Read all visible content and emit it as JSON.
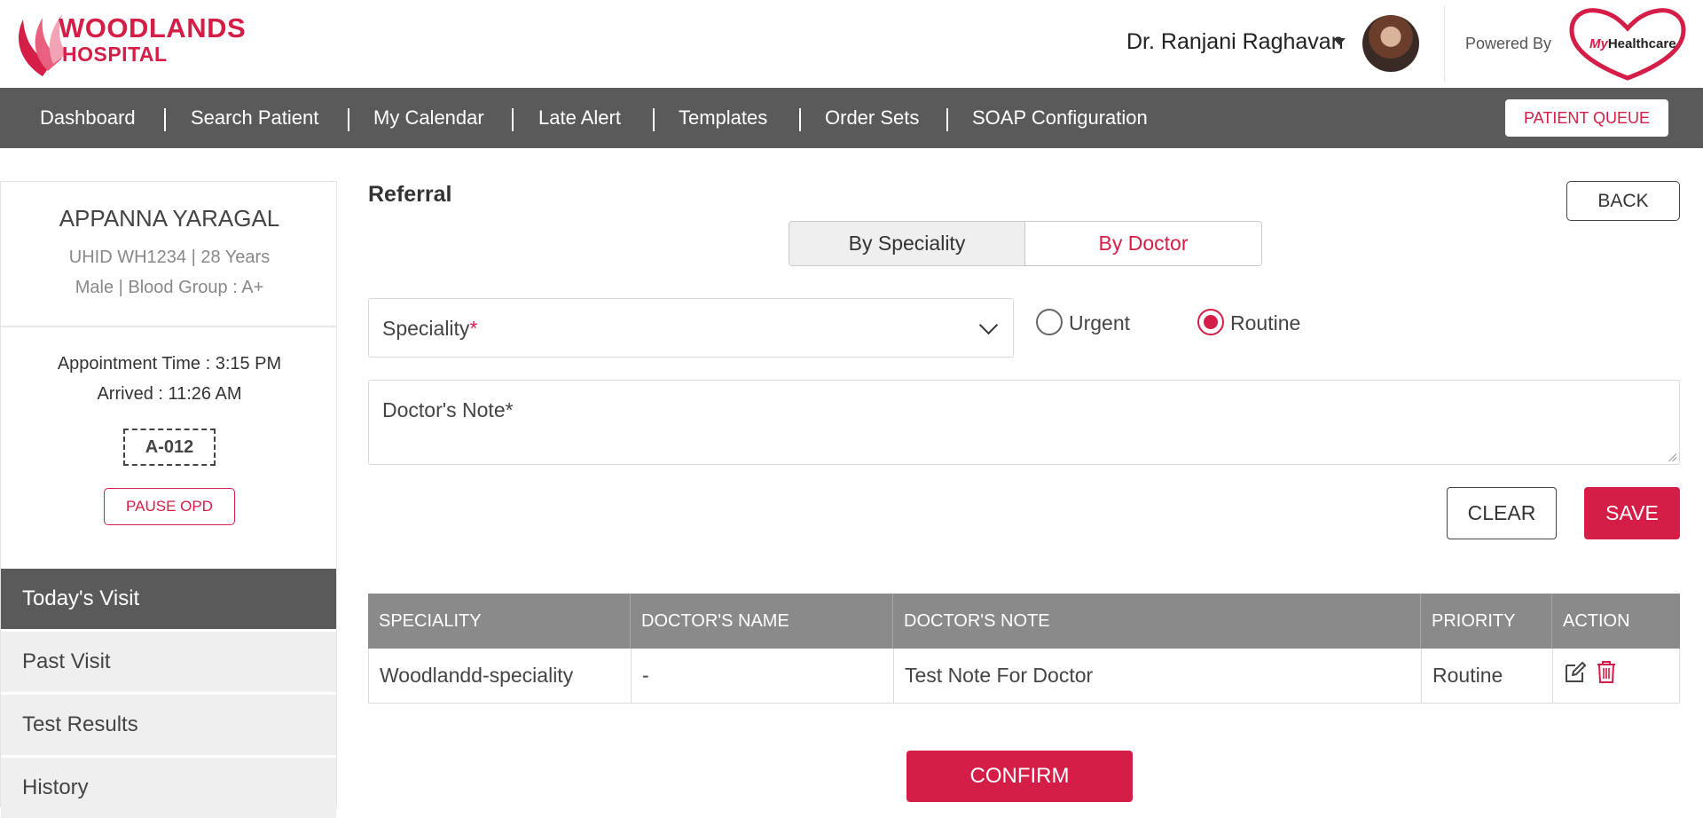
{
  "header": {
    "logo_line1": "WOODLANDS",
    "logo_line2": "HOSPITAL",
    "user_name": "Dr. Ranjani Raghavan",
    "powered_by": "Powered By",
    "partner_logo_prefix": "My",
    "partner_logo_suffix": "Healthcare"
  },
  "nav": {
    "items": [
      "Dashboard",
      "Search Patient",
      "My Calendar",
      "Late Alert",
      "Templates",
      "Order Sets",
      "SOAP Configuration"
    ],
    "queue_button": "PATIENT QUEUE"
  },
  "patient": {
    "name": "APPANNA YARAGAL",
    "meta1": "UHID WH1234 | 28 Years",
    "meta2": "Male | Blood Group : A+",
    "appointment": "Appointment Time : 3:15 PM",
    "arrived": "Arrived : 11:26 AM",
    "token": "A-012",
    "pause_button": "PAUSE OPD"
  },
  "sidebar_tabs": [
    "Today's Visit",
    "Past Visit",
    "Test Results",
    "History"
  ],
  "referral": {
    "title": "Referral",
    "back_button": "BACK",
    "toggle": [
      "By Speciality",
      "By Doctor"
    ],
    "speciality_label": "Speciality",
    "required_mark": "*",
    "priority_options": [
      "Urgent",
      "Routine"
    ],
    "selected_priority": "Routine",
    "note_placeholder": "Doctor's Note*",
    "clear_button": "CLEAR",
    "save_button": "SAVE"
  },
  "table": {
    "headers": [
      "SPECIALITY",
      "DOCTOR'S NAME",
      "DOCTOR'S NOTE",
      "PRIORITY",
      "ACTION"
    ],
    "rows": [
      {
        "speciality": "Woodlandd-speciality",
        "doctor": "-",
        "note": "Test Note For Doctor",
        "priority": "Routine"
      }
    ]
  },
  "confirm_button": "CONFIRM",
  "colors": {
    "brand": "#d41e47",
    "nav_bg": "#5a5a5a",
    "table_header": "#8a8a8a"
  }
}
